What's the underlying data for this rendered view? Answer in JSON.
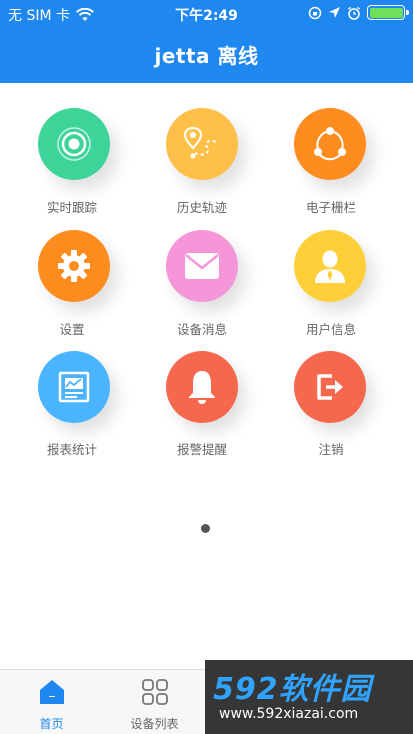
{
  "status": {
    "carrier": "无 SIM 卡",
    "time": "下午2:49",
    "battery_color": "#6ee05a"
  },
  "header": {
    "title": "jetta 离线",
    "color": "#1e87f0"
  },
  "grid": {
    "items": [
      {
        "label": "实时跟踪",
        "icon": "target-icon",
        "color": "#3dd49a"
      },
      {
        "label": "历史轨迹",
        "icon": "map-pin-route-icon",
        "color": "#ffc04a"
      },
      {
        "label": "电子栅栏",
        "icon": "share-nodes-icon",
        "color": "#ff8c1f"
      },
      {
        "label": "设置",
        "icon": "gear-icon",
        "color": "#ff8c1f"
      },
      {
        "label": "设备消息",
        "icon": "envelope-icon",
        "color": "#f596d8"
      },
      {
        "label": "用户信息",
        "icon": "user-icon",
        "color": "#ffcf3a"
      },
      {
        "label": "报表统计",
        "icon": "report-chart-icon",
        "color": "#4ab4ff"
      },
      {
        "label": "报警提醒",
        "icon": "bell-icon",
        "color": "#f5684e"
      },
      {
        "label": "注销",
        "icon": "logout-icon",
        "color": "#f5684e"
      }
    ]
  },
  "tabbar": {
    "tabs": [
      {
        "label": "首页",
        "icon": "home-icon",
        "active": true
      },
      {
        "label": "设备列表",
        "icon": "grid-icon",
        "active": false
      }
    ],
    "active_color": "#1e87f0"
  },
  "watermark": {
    "logo": "592软件园",
    "url": "www.592xiazai.com"
  }
}
